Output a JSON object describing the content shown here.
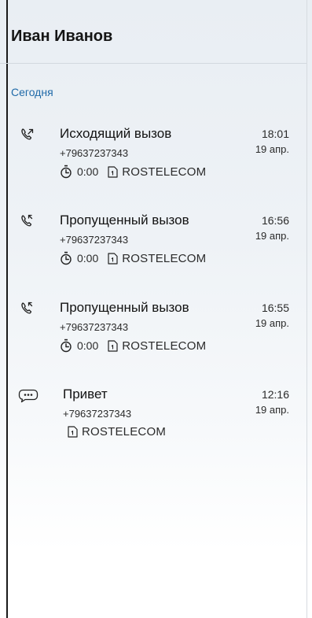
{
  "header": {
    "title": "Иван Иванов"
  },
  "section": {
    "label": "Сегодня"
  },
  "items": [
    {
      "type": "outgoing-call",
      "icon": "outgoing-call-icon",
      "title": "Исходящий вызов",
      "phone": "+79637237343",
      "duration": "0:00",
      "operator": "ROSTELECOM",
      "time": "18:01",
      "date": "19 апр."
    },
    {
      "type": "missed-call",
      "icon": "missed-call-icon",
      "title": "Пропущенный вызов",
      "phone": "+79637237343",
      "duration": "0:00",
      "operator": "ROSTELECOM",
      "time": "16:56",
      "date": "19 апр."
    },
    {
      "type": "missed-call",
      "icon": "missed-call-icon",
      "title": "Пропущенный вызов",
      "phone": "+79637237343",
      "duration": "0:00",
      "operator": "ROSTELECOM",
      "time": "16:55",
      "date": "19 апр."
    },
    {
      "type": "message",
      "icon": "message-bubble-icon",
      "title": "Привет",
      "phone": "+79637237343",
      "operator": "ROSTELECOM",
      "time": "12:16",
      "date": "19 апр."
    }
  ]
}
